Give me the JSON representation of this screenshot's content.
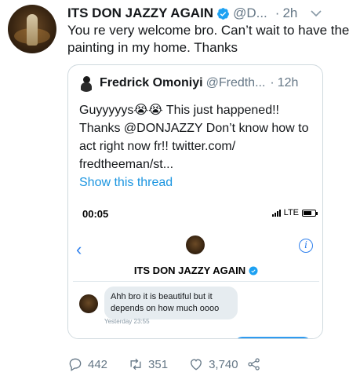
{
  "tweet": {
    "author_name": "ITS DON JAZZY AGAIN",
    "handle": "@D...",
    "separator": "·",
    "time": "2h",
    "text": "You re very welcome bro. Can’t wait to have the painting in my home. Thanks",
    "colors": {
      "verified": "#1da1f2",
      "link": "#1b95e0",
      "muted": "#657786"
    }
  },
  "quote": {
    "author_name": "Fredrick Omoniyi",
    "handle": "@Fredth...",
    "separator": "·",
    "time": "12h",
    "text_prefix": "Guyyyyys",
    "emoji": "😭😭",
    "text_rest": " This just happened!! Thanks @DONJAZZY Don’t know how to act right now fr!! twitter.com/ fredtheeman/st...",
    "show_thread": "Show this thread"
  },
  "screenshot": {
    "status_time": "00:05",
    "network": "LTE",
    "back_icon": "chevron-left-icon",
    "info_icon": "info-icon",
    "conversation_title": "ITS DON JAZZY AGAIN",
    "message_text": "Ahh bro it is beautiful but it depends on how much oooo",
    "message_time": "Yesterday 23:55"
  },
  "actions": {
    "replies": "442",
    "retweets": "351",
    "likes": "3,740"
  }
}
